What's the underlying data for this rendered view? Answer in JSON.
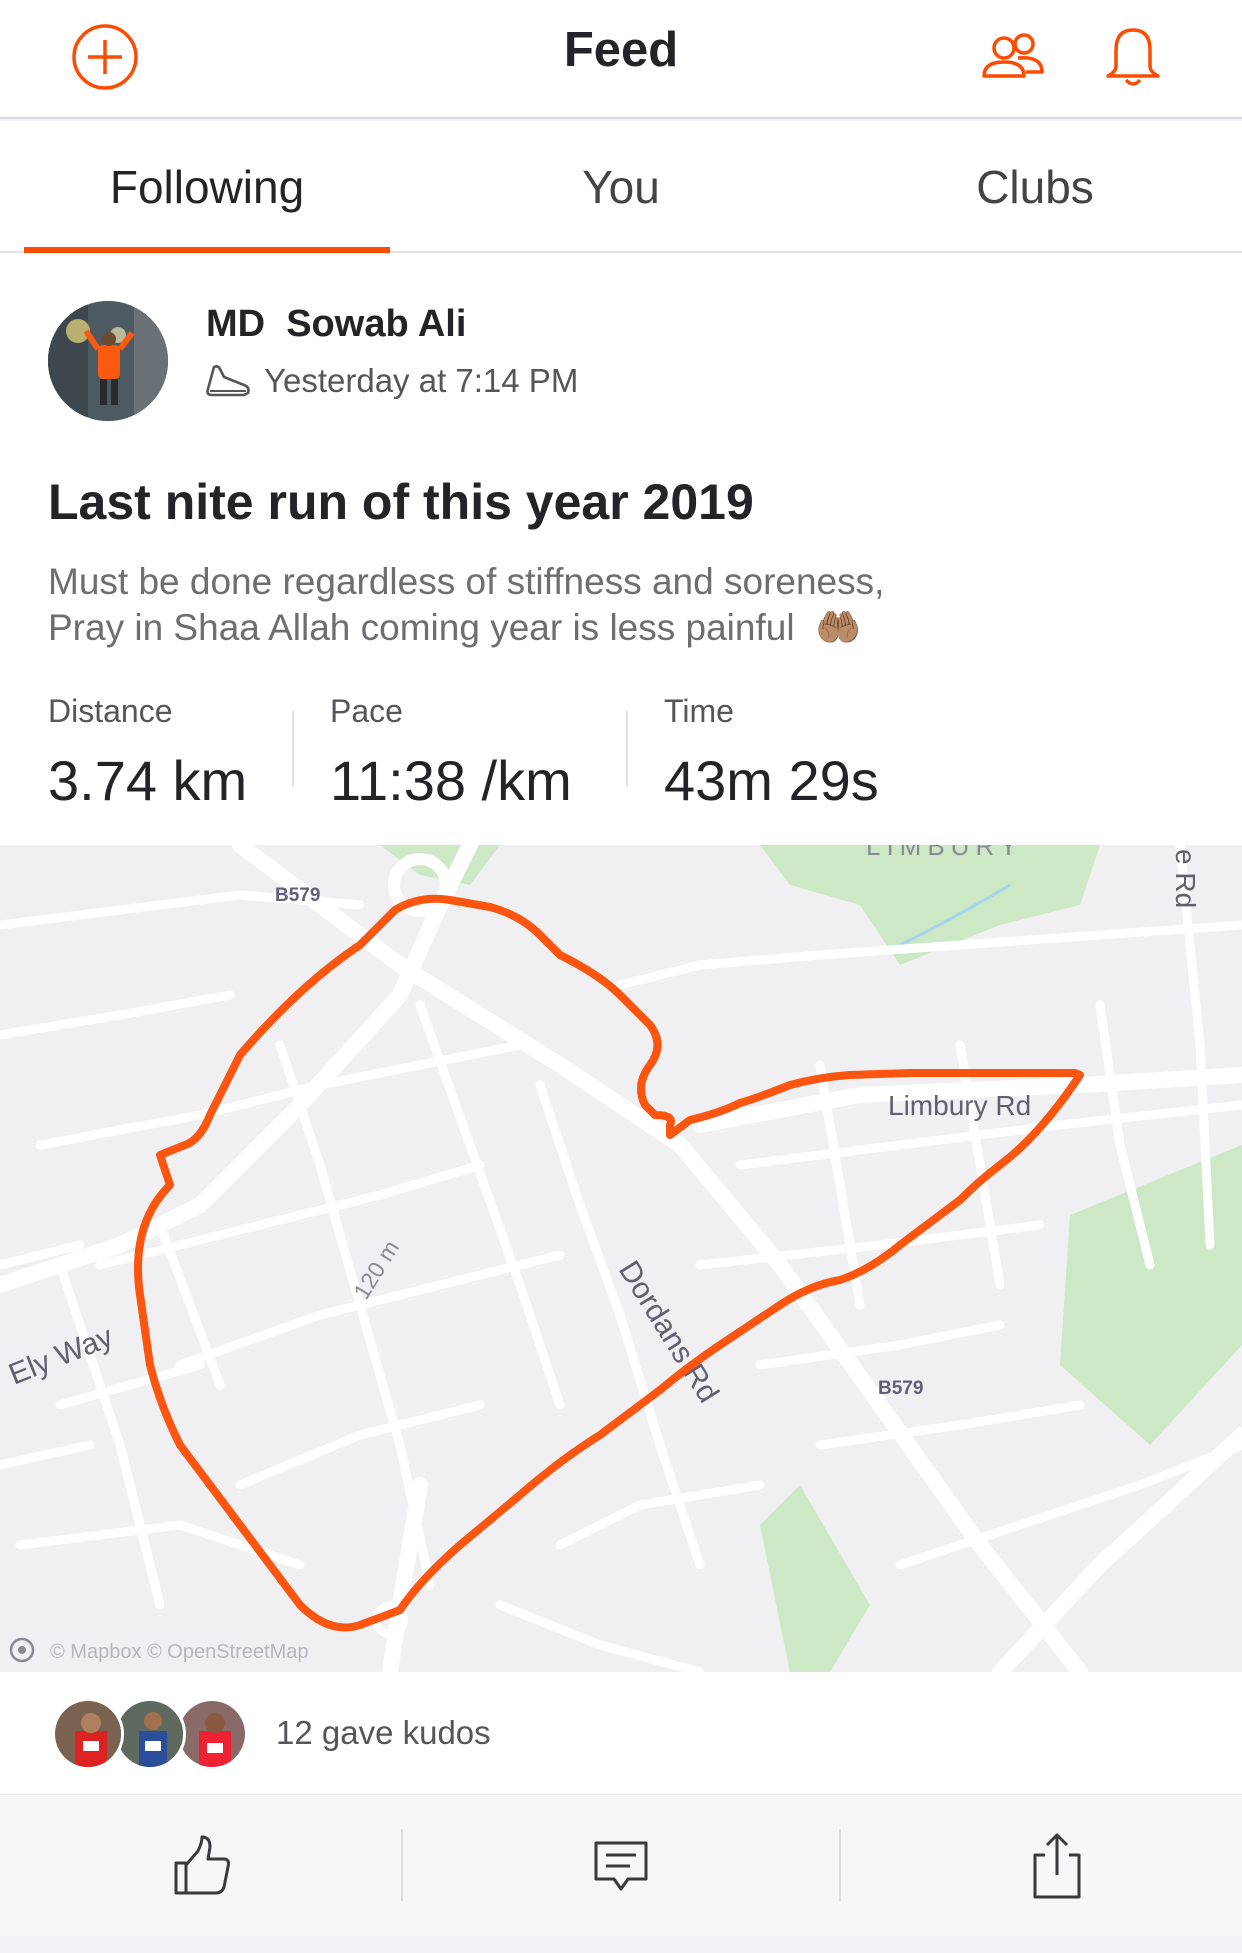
{
  "header": {
    "title": "Feed",
    "icons": {
      "add": "plus-circle-icon",
      "friends": "people-icon",
      "notifications": "bell-icon"
    },
    "accent": "#fc4c02"
  },
  "tabs": [
    {
      "label": "Following",
      "active": true
    },
    {
      "label": "You",
      "active": false
    },
    {
      "label": "Clubs",
      "active": false
    }
  ],
  "activity": {
    "athlete": "MD  Sowab Ali",
    "sport_icon": "shoe-icon",
    "timestamp": "Yesterday at 7:14 PM",
    "title": "Last nite run of this year 2019",
    "description_line1": "Must be done regardless of stiffness and soreness,",
    "description_line2": "Pray in Shaa Allah coming year is less painful",
    "emoji": "🤲🏽",
    "stats": [
      {
        "label": "Distance",
        "value": "3.74 km"
      },
      {
        "label": "Pace",
        "value": "11:38 /km"
      },
      {
        "label": "Time",
        "value": "43m 29s"
      }
    ]
  },
  "map": {
    "labels": {
      "b579_top": "B579",
      "b579_right": "B579",
      "ely_way": "Ely Way",
      "dordans": "Dordans Rd",
      "limbury_rd": "Limbury Rd",
      "limbury_area": "LIMBURY",
      "side_rd": "e Rd",
      "elevation": "120 m",
      "attribution": "© Mapbox © OpenStreetMap"
    },
    "route_color": "#fc4c02"
  },
  "kudos": {
    "text": "12 gave kudos"
  },
  "actions": {
    "kudos": "thumbs-up-icon",
    "comment": "comment-icon",
    "share": "share-icon"
  }
}
